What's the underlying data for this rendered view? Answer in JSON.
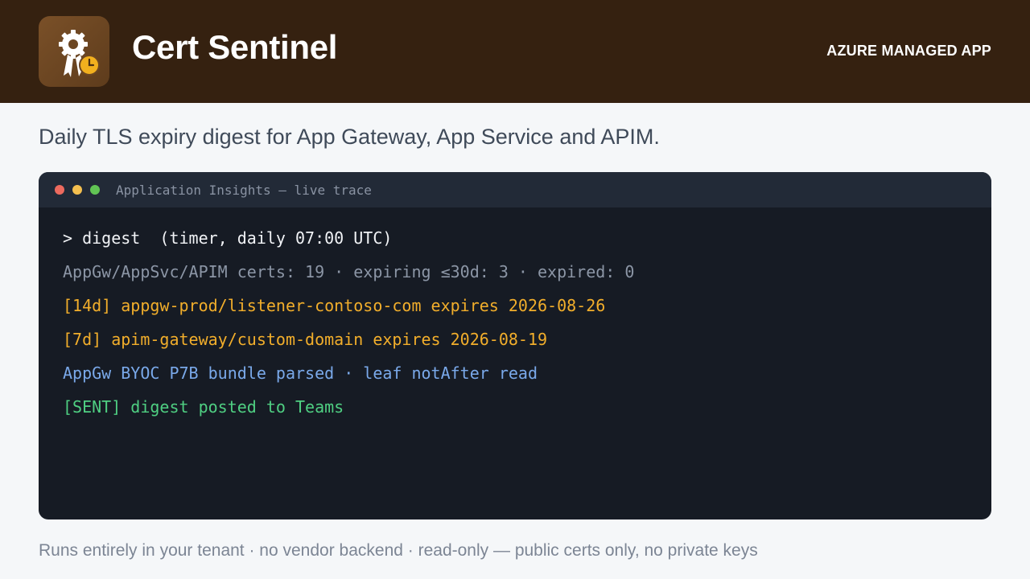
{
  "header": {
    "title": "Cert Sentinel",
    "badge": "AZURE MANAGED APP",
    "logo_icon": "certificate-rosette-clock-icon",
    "background_color": "#352110"
  },
  "tagline": "Daily TLS expiry digest for App Gateway, App Service and APIM.",
  "terminal": {
    "title": "Application Insights — live trace",
    "window_controls": [
      "close-dot",
      "minimize-dot",
      "maximize-dot"
    ],
    "lines": [
      {
        "text": "> digest  (timer, daily 07:00 UTC)",
        "color": "#f1f3f6"
      },
      {
        "text": "AppGw/AppSvc/APIM certs: 19 · expiring ≤30d: 3 · expired: 0",
        "color": "#8c96a6"
      },
      {
        "text": "[14d] appgw-prod/listener-contoso-com expires 2026-08-26",
        "color": "#f2ae2b"
      },
      {
        "text": "[7d] apim-gateway/custom-domain expires 2026-08-19",
        "color": "#f2ae2b"
      },
      {
        "text": "AppGw BYOC P7B bundle parsed · leaf notAfter read",
        "color": "#7aa9ea"
      },
      {
        "text": "[SENT] digest posted to Teams",
        "color": "#4fcf82"
      }
    ]
  },
  "footer": "Runs entirely in your tenant · no vendor backend · read-only — public certs only, no private keys"
}
